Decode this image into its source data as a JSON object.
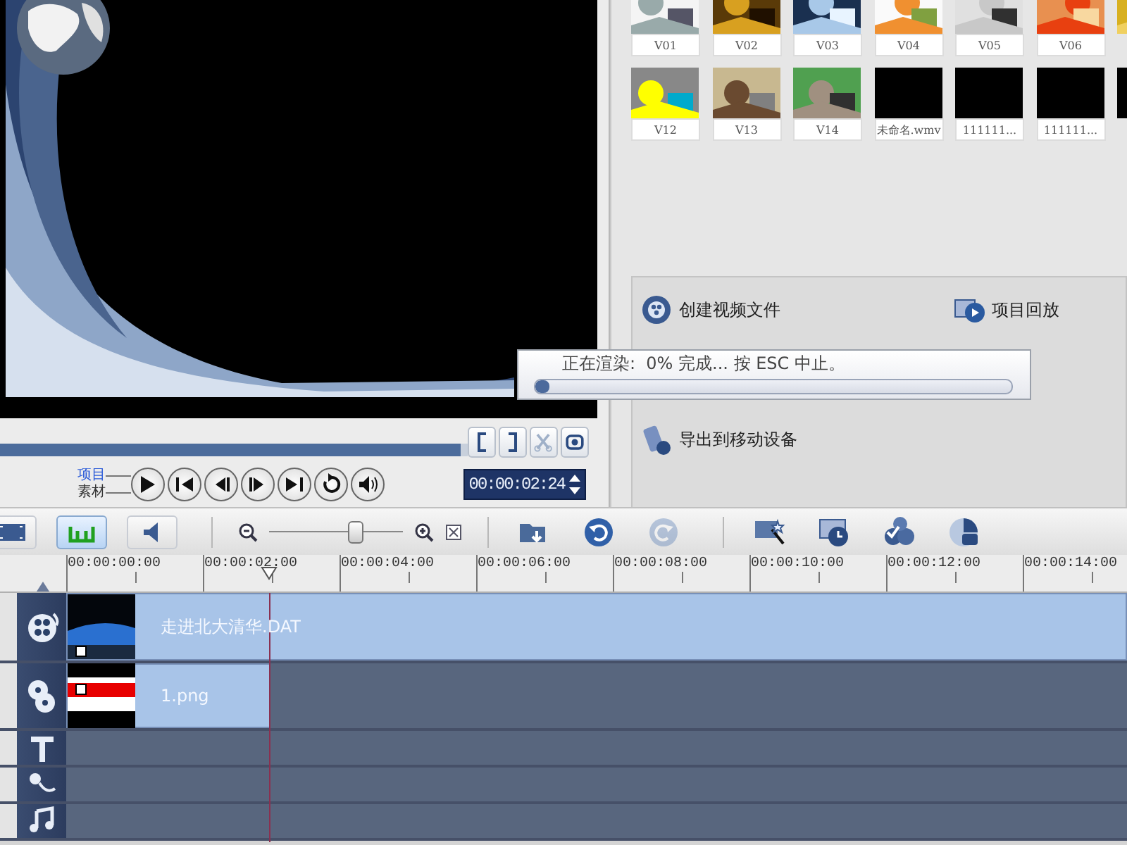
{
  "preview": {
    "scrubber": {
      "level": 0.985
    },
    "modes": [
      {
        "label": "项目",
        "selected": true
      },
      {
        "label": "素材",
        "selected": false
      }
    ],
    "timecode": "00:00:02:24"
  },
  "library": {
    "rows": [
      [
        {
          "label": "V01"
        },
        {
          "label": "V02"
        },
        {
          "label": "V03"
        },
        {
          "label": "V04"
        },
        {
          "label": "V05"
        },
        {
          "label": "V06"
        },
        {}
      ],
      [
        {
          "label": "V12"
        },
        {
          "label": "V13"
        },
        {
          "label": "V14"
        },
        {
          "label": "未命名.wmv"
        },
        {
          "label": "111111..."
        },
        {
          "label": "111111..."
        },
        {}
      ]
    ]
  },
  "tasks": {
    "left": [
      {
        "kind": "video",
        "label": "创建视频文件"
      },
      {
        "kind": "mobile",
        "label": "导出到移动设备"
      }
    ],
    "right": [
      {
        "kind": "playback",
        "label": "项目回放"
      }
    ]
  },
  "render_progress": {
    "message": "正在渲染:  0% 完成... 按 ESC 中止。",
    "level": 0.03
  },
  "toolbar": {
    "view_modes": [
      {
        "kind": "storyboard",
        "selected": false
      },
      {
        "kind": "timeline",
        "selected": true
      },
      {
        "kind": "audio",
        "selected": false
      }
    ],
    "zoom": {
      "level": 0.64
    },
    "buttons": [
      {
        "kind": "insert",
        "disabled": false
      },
      {
        "kind": "undo",
        "disabled": false
      },
      {
        "kind": "redo",
        "disabled": true
      },
      {
        "kind": "smartproxy",
        "disabled": false
      },
      {
        "kind": "chapter",
        "disabled": false
      },
      {
        "kind": "batch",
        "disabled": false
      },
      {
        "kind": "surround",
        "disabled": false
      }
    ]
  },
  "ruler": {
    "ticks": [
      "00:00:00:00",
      "00:00:02:00",
      "00:00:04:00",
      "00:00:06:00",
      "00:00:08:00",
      "00:00:10:00",
      "00:00:12:00",
      "00:00:14:00"
    ]
  },
  "tracks": [
    {
      "kind": "video",
      "clips": [
        {
          "label": "走进北大清华.DAT"
        }
      ]
    },
    {
      "kind": "overlay",
      "clips": [
        {
          "label": "1.png"
        }
      ]
    },
    {
      "kind": "title"
    },
    {
      "kind": "voice"
    },
    {
      "kind": "music"
    }
  ]
}
